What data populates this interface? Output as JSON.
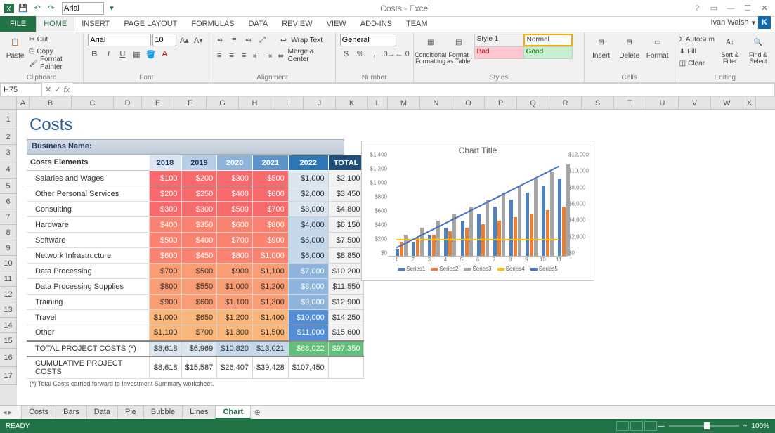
{
  "app": {
    "title": "Costs - Excel",
    "user": "Ivan Walsh",
    "user_initial": "K"
  },
  "qat": {
    "font": "Arial"
  },
  "tabs": {
    "file": "FILE",
    "home": "HOME",
    "insert": "INSERT",
    "pagelayout": "PAGE LAYOUT",
    "formulas": "FORMULAS",
    "data": "DATA",
    "review": "REVIEW",
    "view": "VIEW",
    "addins": "ADD-INS",
    "team": "TEAM"
  },
  "ribbon": {
    "clipboard": {
      "label": "Clipboard",
      "paste": "Paste",
      "cut": "Cut",
      "copy": "Copy",
      "painter": "Format Painter"
    },
    "font": {
      "label": "Font",
      "name": "Arial",
      "size": "10"
    },
    "alignment": {
      "label": "Alignment",
      "wrap": "Wrap Text",
      "merge": "Merge & Center"
    },
    "number": {
      "label": "Number",
      "format": "General"
    },
    "styles": {
      "label": "Styles",
      "cond": "Conditional Formatting",
      "fat": "Format as Table",
      "style1": "Style 1",
      "normal": "Normal",
      "bad": "Bad",
      "good": "Good"
    },
    "cells": {
      "label": "Cells",
      "insert": "Insert",
      "delete": "Delete",
      "format": "Format"
    },
    "editing": {
      "label": "Editing",
      "autosum": "AutoSum",
      "fill": "Fill",
      "clear": "Clear",
      "sort": "Sort & Filter",
      "find": "Find & Select"
    }
  },
  "namebox": "H75",
  "columns": [
    "A",
    "B",
    "C",
    "D",
    "E",
    "F",
    "G",
    "H",
    "I",
    "J",
    "K",
    "L",
    "M",
    "N",
    "O",
    "P",
    "Q",
    "R",
    "S",
    "T",
    "U",
    "V",
    "W",
    "X"
  ],
  "rows": [
    "1",
    "2",
    "3",
    "4",
    "5",
    "6",
    "7",
    "8",
    "9",
    "10",
    "11",
    "12",
    "13",
    "14",
    "15",
    "16",
    "17"
  ],
  "sheet": {
    "title": "Costs",
    "bizname": "Business Name:",
    "col_header": "Costs Elements",
    "years": [
      "2018",
      "2019",
      "2020",
      "2021",
      "2022",
      "TOTAL"
    ],
    "rows": [
      {
        "label": "Salaries and Wages",
        "v": [
          "$100",
          "$200",
          "$300",
          "$500",
          "$1,000",
          "$2,100"
        ]
      },
      {
        "label": "Other Personal Services",
        "v": [
          "$200",
          "$250",
          "$400",
          "$600",
          "$2,000",
          "$3,450"
        ]
      },
      {
        "label": "Consulting",
        "v": [
          "$300",
          "$300",
          "$500",
          "$700",
          "$3,000",
          "$4,800"
        ]
      },
      {
        "label": "Hardware",
        "v": [
          "$400",
          "$350",
          "$600",
          "$800",
          "$4,000",
          "$6,150"
        ]
      },
      {
        "label": "Software",
        "v": [
          "$500",
          "$400",
          "$700",
          "$900",
          "$5,000",
          "$7,500"
        ]
      },
      {
        "label": "Network Infrastructure",
        "v": [
          "$600",
          "$450",
          "$800",
          "$1,000",
          "$6,000",
          "$8,850"
        ]
      },
      {
        "label": "Data Processing",
        "v": [
          "$700",
          "$500",
          "$900",
          "$1,100",
          "$7,000",
          "$10,200"
        ]
      },
      {
        "label": "Data Processing Supplies",
        "v": [
          "$800",
          "$550",
          "$1,000",
          "$1,200",
          "$8,000",
          "$11,550"
        ]
      },
      {
        "label": "Training",
        "v": [
          "$900",
          "$600",
          "$1,100",
          "$1,300",
          "$9,000",
          "$12,900"
        ]
      },
      {
        "label": "Travel",
        "v": [
          "$1,000",
          "$650",
          "$1,200",
          "$1,400",
          "$10,000",
          "$14,250"
        ]
      },
      {
        "label": "Other",
        "v": [
          "$1,100",
          "$700",
          "$1,300",
          "$1,500",
          "$11,000",
          "$15,600"
        ]
      }
    ],
    "total_label": "TOTAL PROJECT COSTS  (*)",
    "total": [
      "$8,618",
      "$6,969",
      "$10,820",
      "$13,021",
      "$68,022",
      "$97,350"
    ],
    "cum_label": "CUMULATIVE PROJECT COSTS",
    "cum": [
      "$8,618",
      "$15,587",
      "$26,407",
      "$39,428",
      "$107,450",
      ""
    ],
    "footnote": "(*) Total Costs carried forward to Investment Summary worksheet."
  },
  "chart": {
    "title": "Chart Title",
    "legend": [
      "Series1",
      "Series2",
      "Series3",
      "Series4",
      "Series5"
    ],
    "yticks_left": [
      "$0",
      "$200",
      "$400",
      "$600",
      "$800",
      "$1,000",
      "$1,200",
      "$1,400"
    ],
    "yticks_right": [
      "$0",
      "$2,000",
      "$4,000",
      "$6,000",
      "$8,000",
      "$10,000",
      "$12,000"
    ],
    "xticks": [
      "1",
      "2",
      "3",
      "4",
      "5",
      "6",
      "7",
      "8",
      "9",
      "10",
      "11"
    ]
  },
  "chart_data": {
    "type": "bar",
    "title": "Chart Title",
    "categories": [
      1,
      2,
      3,
      4,
      5,
      6,
      7,
      8,
      9,
      10,
      11
    ],
    "series": [
      {
        "name": "Series1",
        "type": "bar",
        "axis": "left",
        "values": [
          100,
          200,
          300,
          400,
          500,
          600,
          700,
          800,
          900,
          1000,
          1100
        ]
      },
      {
        "name": "Series2",
        "type": "bar",
        "axis": "left",
        "values": [
          200,
          250,
          300,
          350,
          400,
          450,
          500,
          550,
          600,
          650,
          700
        ]
      },
      {
        "name": "Series3",
        "type": "bar",
        "axis": "left",
        "values": [
          300,
          400,
          500,
          600,
          700,
          800,
          900,
          1000,
          1100,
          1200,
          1300
        ]
      },
      {
        "name": "Series4",
        "type": "line",
        "axis": "right",
        "values": [
          2000,
          2000,
          2000,
          2000,
          2000,
          2000,
          2000,
          2000,
          2000,
          2000,
          2000
        ]
      },
      {
        "name": "Series5",
        "type": "line",
        "axis": "right",
        "values": [
          1000,
          2000,
          3000,
          4000,
          5000,
          6000,
          7000,
          8000,
          9000,
          10000,
          11000
        ]
      }
    ],
    "ylabel_left": "",
    "ylim_left": [
      0,
      1400
    ],
    "ylabel_right": "",
    "ylim_right": [
      0,
      12000
    ],
    "xlabel": ""
  },
  "sheets": [
    "Costs",
    "Bars",
    "Data",
    "Pie",
    "Bubble",
    "Lines",
    "Chart"
  ],
  "active_sheet": "Chart",
  "status": {
    "ready": "READY",
    "zoom": "100%"
  }
}
